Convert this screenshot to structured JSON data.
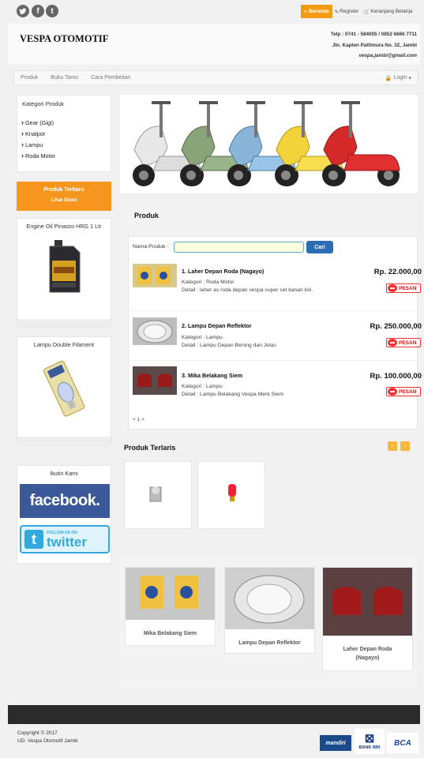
{
  "topbar": {
    "social": [
      {
        "name": "twitter-icon",
        "glyph": "t"
      },
      {
        "name": "facebook-icon",
        "glyph": "f"
      },
      {
        "name": "tumblr-icon",
        "glyph": "t"
      }
    ],
    "nav": {
      "beranda": "Beranda",
      "register": "Register",
      "keranjang": "Keranjang Belanja"
    }
  },
  "header": {
    "brand": "VESPA OTOMOTIF",
    "phone": "Telp : 0741 - 584005 / 0852 6666 7711",
    "address": "Jln. Kapten Pattimura No. 32, Jambi",
    "email": "vespa.jambi@gmail.com"
  },
  "nav": {
    "items": [
      "Produk",
      "Buku Tamu",
      "Cara Pembelian"
    ],
    "login": "Login"
  },
  "sidebar": {
    "kategori_title": "Kategori Produk",
    "kategori": [
      "Gear (Gigi)",
      "Knalpot",
      "Lampu",
      "Roda Motor"
    ],
    "terbaru_title": "Produk Terbaru",
    "terbaru_link": "Lihat Disini",
    "card1_title": "Engine Oil Pinasco HRG 1 Ltr",
    "card2_title": "Lampu Double Filament",
    "ikuti_title": "Ikutin Kami",
    "facebook": "facebook.",
    "twitter_small": "FOLLOW US ON",
    "twitter": "twitter"
  },
  "main": {
    "produk_title": "Produk",
    "search_label": "Nama Produk :",
    "search_value": "",
    "cari": "Cari",
    "products": [
      {
        "name": "1. Laher Depan Roda (Nagayo)",
        "kategori": "Kategori : Roda Motor",
        "detail": "Detail : laher as roda depan vespa super set kanan kiri.",
        "price": "Rp. 22.000,00",
        "pesan": "PESAN"
      },
      {
        "name": "2. Lampu Depan Reflektor",
        "kategori": "Kategori : Lampu",
        "detail": "Detail : Lampu Depan Bening dan Jelas",
        "price": "Rp. 250.000,00",
        "pesan": "PESAN"
      },
      {
        "name": "3. Mika Belakang Siem",
        "kategori": "Kategori : Lampu",
        "detail": "Detail : Lampu Belakang Vespa Merk Siem",
        "price": "Rp. 100.000,00",
        "pesan": "PESAN"
      }
    ],
    "pagination": "< 1 >",
    "terlaris_title": "Produk Terlaris",
    "featured": [
      "Mika Belakang Siem",
      "Lampu Depan Reflektor",
      "Laher Depan Roda (Nagayo)"
    ]
  },
  "footer": {
    "copyright": "Copyright © 2017",
    "company": "UD. Vespa Otomotif Jambi",
    "banks": [
      "mandiri",
      "BANK BRI",
      "BCA"
    ]
  },
  "colors": {
    "accent": "#f39c12",
    "orange_box": "#f7961d",
    "button_blue": "#2a6db5",
    "pesan_red": "#e33333"
  }
}
